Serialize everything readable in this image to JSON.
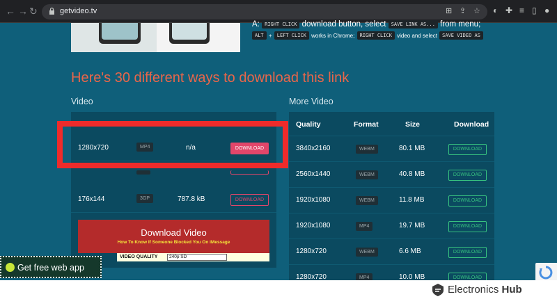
{
  "browser": {
    "url": "getvideo.tv"
  },
  "instructions": {
    "prefix": "A:",
    "right_click": "RIGHT CLICK",
    "mid": "download button, select",
    "save_link": "SAVE LINK AS...",
    "suffix": "from menu;",
    "alt": "ALT",
    "plus": "+",
    "left_click": "LEFT CLICK",
    "chrome_text": "works in Chrome;",
    "right_click2": "RIGHT CLICK",
    "video_select": "video and select",
    "save_video": "SAVE VIDEO AS"
  },
  "heading": "Here's 30 different ways to download this link",
  "video_section": {
    "title": "Video",
    "rows": [
      {
        "resolution": "1280x720",
        "format": "MP4",
        "size": "n/a",
        "button": "DOWNLOAD"
      },
      {
        "resolution": "176x144",
        "format": "3GP",
        "size": "787.8 kB",
        "button": "DOWNLOAD"
      }
    ]
  },
  "ad": {
    "title": "Download Video",
    "subtitle": "How To Know If Someone Blocked You On iMessage",
    "quality_label": "VIDEO QUALITY",
    "quality_value": "240p SD"
  },
  "more_section": {
    "title": "More Video",
    "headers": [
      "Quality",
      "Format",
      "Size",
      "Download"
    ],
    "rows": [
      {
        "quality": "3840x2160",
        "format": "WEBM",
        "size": "80.1 MB",
        "button": "DOWNLOAD"
      },
      {
        "quality": "2560x1440",
        "format": "WEBM",
        "size": "40.8 MB",
        "button": "DOWNLOAD"
      },
      {
        "quality": "1920x1080",
        "format": "WEBM",
        "size": "11.8 MB",
        "button": "DOWNLOAD"
      },
      {
        "quality": "1920x1080",
        "format": "MP4",
        "size": "19.7 MB",
        "button": "DOWNLOAD"
      },
      {
        "quality": "1280x720",
        "format": "WEBM",
        "size": "6.6 MB",
        "button": "DOWNLOAD"
      },
      {
        "quality": "1280x720",
        "format": "MP4",
        "size": "10.0 MB",
        "button": "DOWNLOAD"
      }
    ]
  },
  "get_app": "Get free web app",
  "footer": {
    "brand_light": "Electronics",
    "brand_bold": "Hub"
  },
  "colors": {
    "page_bg": "#0f5f7a",
    "panel_bg": "#0b4a60",
    "heading": "#e9664a",
    "download_pink": "#e2466a",
    "download_green": "#37c27f",
    "highlight": "#ee2b2b"
  }
}
